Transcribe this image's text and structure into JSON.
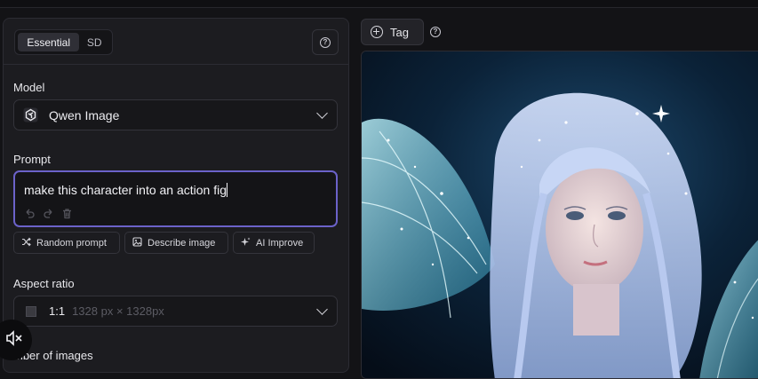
{
  "tabs": {
    "essential": "Essential",
    "sd": "SD"
  },
  "model": {
    "label": "Model",
    "value": "Qwen Image"
  },
  "prompt": {
    "label": "Prompt",
    "value": "make this character into an action fig"
  },
  "prompt_actions": {
    "random": "Random prompt",
    "describe": "Describe image",
    "improve": "AI Improve"
  },
  "aspect": {
    "label": "Aspect ratio",
    "value": "1:1",
    "dims": "1328 px × 1328px"
  },
  "images": {
    "label": "mber of images"
  },
  "tag": {
    "label": "Tag"
  },
  "colors": {
    "accent": "#6b62c9",
    "panel": "#1c1c20",
    "background": "#131316"
  }
}
